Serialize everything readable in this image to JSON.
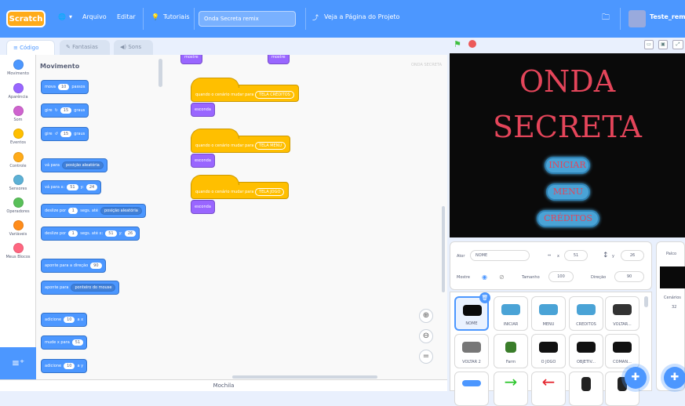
{
  "menubar": {
    "logo": "Scratch",
    "globe": "🌐",
    "file": "Arquivo",
    "edit": "Editar",
    "tutorials": "Tutoriais",
    "project_title": "Onda Secreta  remix",
    "share_icon": "⤴",
    "see_project": "Veja a Página do Projeto",
    "username": "Teste_remix"
  },
  "tabs": {
    "code": "Código",
    "costumes": "Fantasias",
    "sounds": "Sons"
  },
  "categories": [
    {
      "label": "Movimento",
      "color": "#4c97ff"
    },
    {
      "label": "Aparência",
      "color": "#9966ff"
    },
    {
      "label": "Som",
      "color": "#cf63cf"
    },
    {
      "label": "Eventos",
      "color": "#ffbf00"
    },
    {
      "label": "Controle",
      "color": "#ffab19"
    },
    {
      "label": "Sensores",
      "color": "#5cb1d6"
    },
    {
      "label": "Operadores",
      "color": "#59c059"
    },
    {
      "label": "Variáveis",
      "color": "#ff8c1a"
    },
    {
      "label": "Meus Blocos",
      "color": "#ff6680"
    }
  ],
  "palette": {
    "title": "Movimento",
    "move": {
      "a": "mova",
      "v": "10",
      "b": "passos"
    },
    "turn_right": {
      "a": "gire",
      "v": "15",
      "b": "graus"
    },
    "turn_left": {
      "a": "gire",
      "v": "15",
      "b": "graus"
    },
    "goto": {
      "a": "vá para",
      "d": "posição aleatória"
    },
    "goto_xy": {
      "a": "vá para x:",
      "x": "51",
      "b": "y:",
      "y": "24"
    },
    "glide": {
      "a": "deslize por",
      "v": "1",
      "b": "segs. até",
      "d": "posição aleatória"
    },
    "glide_xy": {
      "a": "deslize por",
      "v": "1",
      "b": "segs. até x:",
      "x": "51",
      "c": "y:",
      "y": "26"
    },
    "point_dir": {
      "a": "aponte para a direção",
      "v": "90"
    },
    "point_to": {
      "a": "aponte para",
      "d": "ponteiro do mouse"
    },
    "change_x": {
      "a": "adicione",
      "v": "10",
      "b": "a x"
    },
    "set_x": {
      "a": "mude x para",
      "v": "51"
    },
    "change_y": {
      "a": "adicione",
      "v": "10",
      "b": "a y"
    }
  },
  "workspace": {
    "top_a": "mostre",
    "top_b": "mostre",
    "watermark": "ONDA SECRETA",
    "event1": {
      "a": "quando o cenário mudar para",
      "d": "TELA CRÉDITOS"
    },
    "look1": "esconda",
    "event2": {
      "a": "quando o cenário mudar para",
      "d": "TELA MENU"
    },
    "look2": "esconda",
    "event3": {
      "a": "quando o cenário mudar para",
      "d": "TELA JOGO"
    },
    "look3": "esconda",
    "backpack": "Mochila"
  },
  "stage": {
    "title_line1": "ONDA",
    "title_line2": "SECRETA",
    "btn_start": "INICIAR",
    "btn_menu": "MENU",
    "btn_credits": "CRÉDITOS"
  },
  "sprite_info": {
    "sprite_label": "Ator",
    "sprite_name": "NOME",
    "x_label": "x",
    "x_val": "51",
    "y_label": "y",
    "y_val": "26",
    "show_label": "Mostre",
    "size_label": "Tamanho",
    "size_val": "100",
    "dir_label": "Direção",
    "dir_val": "90"
  },
  "sprites": [
    {
      "name": "NOME",
      "color": "#e4455a",
      "selected": true
    },
    {
      "name": "INICIAR",
      "color": "#4aa3d6"
    },
    {
      "name": "MENU",
      "color": "#4aa3d6"
    },
    {
      "name": "CRÉDITOS",
      "color": "#4aa3d6"
    },
    {
      "name": "VOLTAR...",
      "color": "#333333"
    },
    {
      "name": "VOLTAR 2",
      "color": "#777777"
    },
    {
      "name": "Farm",
      "color": "#3a7d2a"
    },
    {
      "name": "O JOGO",
      "color": "#111111"
    },
    {
      "name": "OBJETIV...",
      "color": "#111111"
    },
    {
      "name": "COMAN...",
      "color": "#111111"
    }
  ],
  "stage_panel": {
    "label": "Palco",
    "backdrops_label": "Cenários",
    "backdrops_count": "32"
  }
}
